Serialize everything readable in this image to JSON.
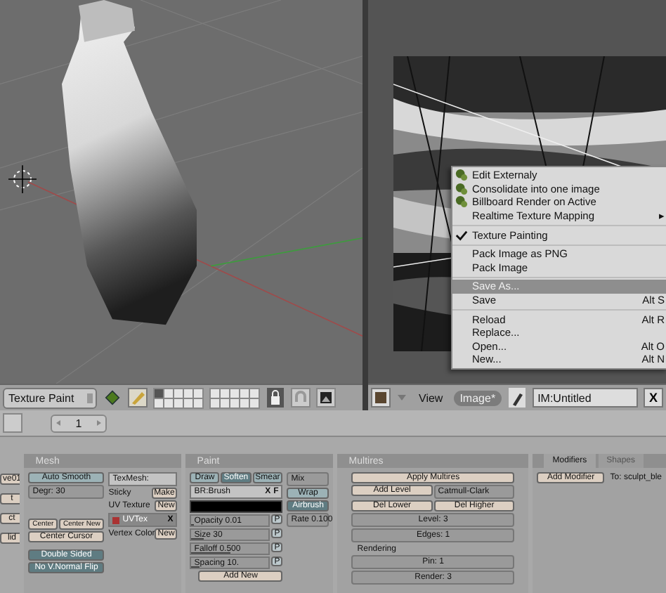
{
  "viewport": {
    "mode": "Texture Paint"
  },
  "image_editor": {
    "menus": [
      {
        "label": "View",
        "selected": false
      },
      {
        "label": "Image*",
        "selected": true
      }
    ],
    "image_name": "IM:Untitled",
    "close": "X"
  },
  "image_menu": {
    "items": [
      {
        "kind": "icon",
        "label": "Edit Externaly",
        "selected": false
      },
      {
        "kind": "icon",
        "label": "Consolidate into one image",
        "selected": false
      },
      {
        "kind": "icon",
        "label": "Billboard Render on Active",
        "selected": false
      },
      {
        "kind": "submenu",
        "label": "Realtime Texture Mapping",
        "arrow": "▸",
        "selected": false
      },
      {
        "kind": "separator"
      },
      {
        "kind": "check",
        "label": "Texture Painting",
        "checked": true,
        "selected": false
      },
      {
        "kind": "separator"
      },
      {
        "kind": "plain",
        "label": "Pack Image as PNG",
        "selected": false
      },
      {
        "kind": "plain",
        "label": "Pack Image",
        "selected": false
      },
      {
        "kind": "separator"
      },
      {
        "kind": "plain",
        "label": "Save As...",
        "selected": true
      },
      {
        "kind": "plain",
        "label": "Save",
        "shortcut": "Alt S",
        "selected": false
      },
      {
        "kind": "separator"
      },
      {
        "kind": "plain",
        "label": "Reload",
        "shortcut": "Alt R",
        "selected": false
      },
      {
        "kind": "plain",
        "label": "Replace...",
        "selected": false
      },
      {
        "kind": "plain",
        "label": "Open...",
        "shortcut": "Alt O",
        "selected": false
      },
      {
        "kind": "plain",
        "label": "New...",
        "shortcut": "Alt N",
        "selected": false
      }
    ]
  },
  "buttons_header": {
    "frame": "1"
  },
  "left_edge_buttons": [
    "ve01",
    "t",
    "ct",
    "lid"
  ],
  "mesh_panel": {
    "title": "Mesh",
    "auto_smooth": "Auto Smooth",
    "degr": "Degr: 30",
    "texmesh": "TexMesh:",
    "rows": [
      {
        "label": "Sticky",
        "button": "Make"
      },
      {
        "label": "UV Texture",
        "button": "New"
      }
    ],
    "uv_layer": "UVTex",
    "uv_remove": "X",
    "vertex_color": {
      "label": "Vertex Color",
      "button": "New"
    },
    "center_buttons": [
      "Center",
      "Center New"
    ],
    "center_cursor": "Center Cursor",
    "double_sided": "Double Sided",
    "normal_flip": "No V.Normal Flip"
  },
  "paint_panel": {
    "title": "Paint",
    "tools": [
      {
        "label": "Draw",
        "selected": false
      },
      {
        "label": "Soften",
        "selected": true
      },
      {
        "label": "Smear",
        "selected": false
      }
    ],
    "brush": "BR:Brush",
    "brush_remove": "X",
    "brush_fake": "F",
    "color": "#000000",
    "sliders": [
      {
        "label": "Opacity 0.01",
        "level": 0.01,
        "pressure": "P"
      },
      {
        "label": "Size 30",
        "level": 0.15,
        "pressure": "P"
      },
      {
        "label": "Falloff 0.500",
        "level": 0.5,
        "pressure": "P"
      },
      {
        "label": "Spacing 10.",
        "level": 0.1,
        "pressure": "P"
      }
    ],
    "add_new": "Add New",
    "blend": "Mix",
    "wrap": "Wrap",
    "airbrush": {
      "label": "Airbrush",
      "on": true
    },
    "rate": "Rate 0.100"
  },
  "multires_panel": {
    "title": "Multires",
    "apply": "Apply Multires",
    "add_level": "Add Level",
    "subdiv": "Catmull-Clark",
    "del_lower": "Del Lower",
    "del_higher": "Del Higher",
    "fields": [
      "Level: 3",
      "Edges: 1"
    ],
    "rendering_label": "Rendering",
    "render_fields": [
      "Pin: 1",
      "Render: 3"
    ]
  },
  "modifiers_panel": {
    "tabs": [
      {
        "label": "Modifiers",
        "selected": true
      },
      {
        "label": "Shapes",
        "selected": false
      }
    ],
    "add_modifier": "Add Modifier",
    "target": "To: sculpt_ble"
  }
}
